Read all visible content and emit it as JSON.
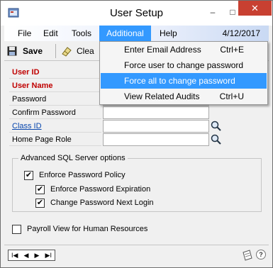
{
  "window": {
    "title": "User Setup",
    "icon": "app-window-icon",
    "controls": {
      "minimize": "–",
      "maximize": "□",
      "close": "✕"
    }
  },
  "menu": {
    "items": [
      {
        "label": "File"
      },
      {
        "label": "Edit"
      },
      {
        "label": "Tools"
      },
      {
        "label": "Additional"
      },
      {
        "label": "Help"
      }
    ],
    "date": "4/12/2017"
  },
  "toolbar": {
    "save_label": "Save",
    "clear_label": "Clea"
  },
  "form": {
    "rows": [
      {
        "label": "User ID",
        "style": "required"
      },
      {
        "label": "User Name",
        "style": "required"
      },
      {
        "label": "Password",
        "style": "normal"
      },
      {
        "label": "Confirm Password",
        "style": "normal"
      },
      {
        "label": "Class ID",
        "style": "link"
      },
      {
        "label": "Home Page Role",
        "style": "normal"
      }
    ]
  },
  "sql_options": {
    "title": "Advanced SQL Server options",
    "enforce_policy": {
      "label": "Enforce Password Policy",
      "checked": true
    },
    "enforce_expiration": {
      "label": "Enforce Password Expiration",
      "checked": true
    },
    "change_next_login": {
      "label": "Change Password Next Login",
      "checked": true
    }
  },
  "payroll": {
    "label": "Payroll View for Human Resources",
    "checked": false
  },
  "navigation": {
    "first": "I◀",
    "prev": "◀",
    "next": "▶",
    "last": "▶I"
  },
  "additional_menu": {
    "items": [
      {
        "label": "Enter Email Address",
        "shortcut": "Ctrl+E"
      },
      {
        "label": "Force user to change password",
        "shortcut": ""
      },
      {
        "label": "Force all to change password",
        "shortcut": ""
      },
      {
        "label": "View Related Audits",
        "shortcut": "Ctrl+U"
      }
    ],
    "highlighted": "Force all to change password"
  },
  "colors": {
    "menu_highlight": "#3399ff",
    "required_label": "#c00000",
    "link": "#0645ad",
    "close_button": "#c84031"
  }
}
